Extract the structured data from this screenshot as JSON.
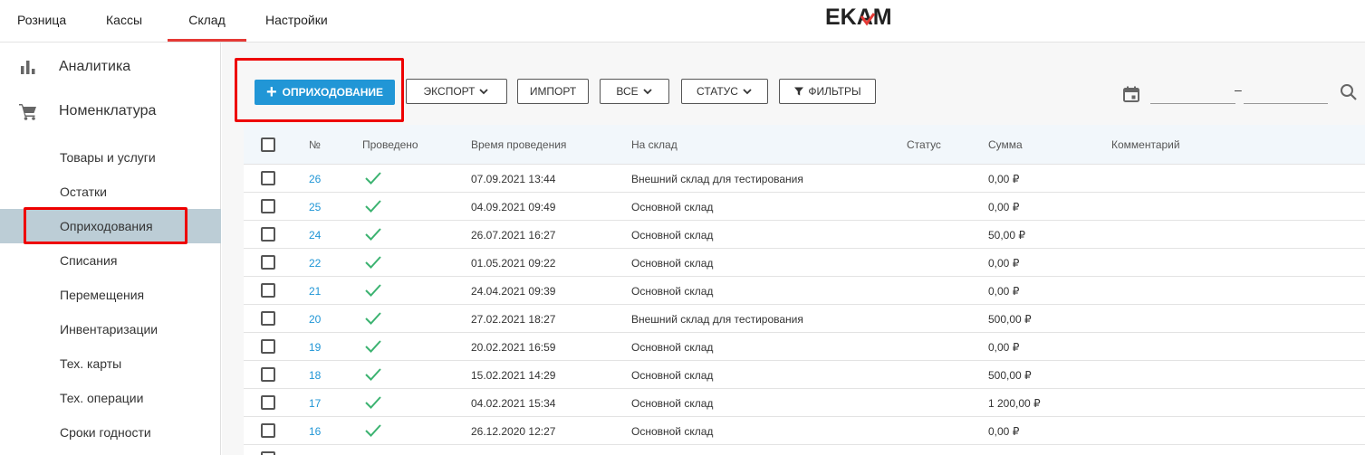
{
  "top_nav": {
    "tabs": [
      {
        "label": "Розница",
        "active": false
      },
      {
        "label": "Кассы",
        "active": false
      },
      {
        "label": "Склад",
        "active": true
      },
      {
        "label": "Настройки",
        "active": false
      }
    ],
    "logo_text": "EKAM"
  },
  "sidebar": {
    "main_items": [
      {
        "label": "Аналитика",
        "icon": "bar-chart-icon"
      },
      {
        "label": "Номенклатура",
        "icon": "shopping-cart-icon"
      }
    ],
    "sub_items": [
      {
        "label": "Товары и услуги",
        "active": false
      },
      {
        "label": "Остатки",
        "active": false
      },
      {
        "label": "Оприходования",
        "active": true
      },
      {
        "label": "Списания",
        "active": false
      },
      {
        "label": "Перемещения",
        "active": false
      },
      {
        "label": "Инвентаризации",
        "active": false
      },
      {
        "label": "Тех. карты",
        "active": false
      },
      {
        "label": "Тех. операции",
        "active": false
      },
      {
        "label": "Сроки годности",
        "active": false
      }
    ]
  },
  "toolbar": {
    "add_label": "ОПРИХОДОВАНИЕ",
    "export_label": "ЭКСПОРТ",
    "import_label": "ИМПОРТ",
    "all_label": "ВСЕ",
    "status_label": "СТАТУС",
    "filters_label": "ФИЛЬТРЫ",
    "date_separator": "–"
  },
  "table": {
    "headers": [
      "№",
      "Проведено",
      "Время проведения",
      "На склад",
      "Статус",
      "Сумма",
      "Комментарий"
    ],
    "rows": [
      {
        "num": "26",
        "time": "07.09.2021 13:44",
        "warehouse": "Внешний склад для тестирования",
        "sum": "0,00 ₽"
      },
      {
        "num": "25",
        "time": "04.09.2021 09:49",
        "warehouse": "Основной склад",
        "sum": "0,00 ₽"
      },
      {
        "num": "24",
        "time": "26.07.2021 16:27",
        "warehouse": "Основной склад",
        "sum": "50,00 ₽"
      },
      {
        "num": "22",
        "time": "01.05.2021 09:22",
        "warehouse": "Основной склад",
        "sum": "0,00 ₽"
      },
      {
        "num": "21",
        "time": "24.04.2021 09:39",
        "warehouse": "Основной склад",
        "sum": "0,00 ₽"
      },
      {
        "num": "20",
        "time": "27.02.2021 18:27",
        "warehouse": "Внешний склад для тестирования",
        "sum": "500,00 ₽"
      },
      {
        "num": "19",
        "time": "20.02.2021 16:59",
        "warehouse": "Основной склад",
        "sum": "0,00 ₽"
      },
      {
        "num": "18",
        "time": "15.02.2021 14:29",
        "warehouse": "Основной склад",
        "sum": "500,00 ₽"
      },
      {
        "num": "17",
        "time": "04.02.2021 15:34",
        "warehouse": "Основной склад",
        "sum": "1 200,00 ₽"
      },
      {
        "num": "16",
        "time": "26.12.2020 12:27",
        "warehouse": "Основной склад",
        "sum": "0,00 ₽"
      }
    ]
  },
  "colors": {
    "accent": "#2196d6",
    "active_tab_underline": "#e53935",
    "active_sidebar": "#bccdd6",
    "check_green": "#3cb371",
    "highlight_red": "#ee0000"
  }
}
